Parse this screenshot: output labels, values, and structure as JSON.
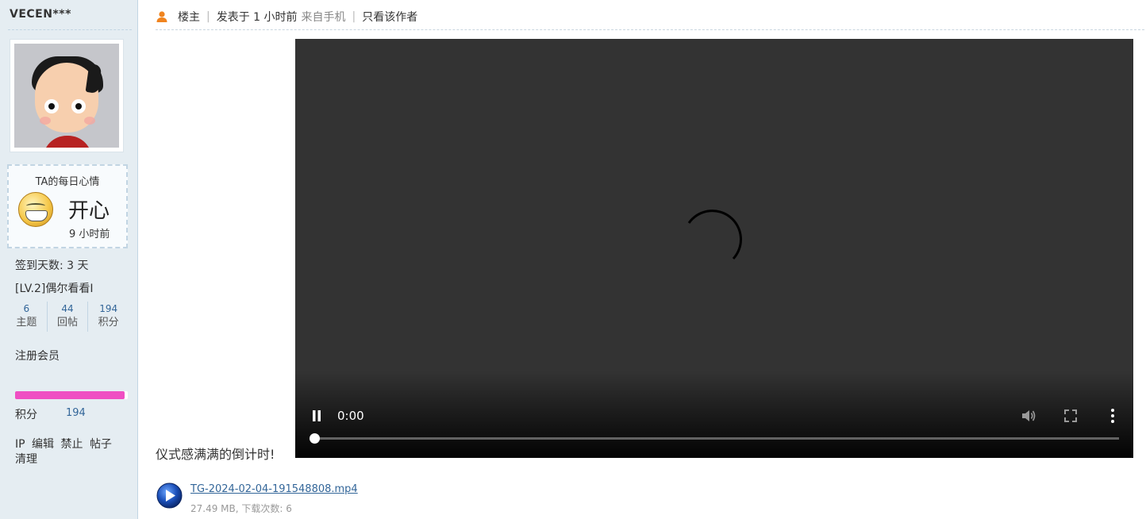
{
  "sidebar": {
    "username": "VECEN***",
    "mood": {
      "title": "TA的每日心情",
      "value": "开心",
      "time": "9 小时前"
    },
    "checkin": "签到天数: 3 天",
    "level": "[LV.2]偶尔看看I",
    "stats": [
      {
        "value": "6",
        "label": "主题"
      },
      {
        "value": "44",
        "label": "回帖"
      },
      {
        "value": "194",
        "label": "积分"
      }
    ],
    "member_group": "注册会员",
    "points_progress": 0.97,
    "points_label": "积分",
    "points_value": "194",
    "admin_links": [
      "IP",
      "编辑",
      "禁止",
      "帖子",
      "清理"
    ]
  },
  "post": {
    "role": "楼主",
    "posted": "发表于 1 小时前",
    "device": "来自手机",
    "only_author": "只看该作者",
    "separator": "|",
    "text": "仪式感满满的倒计时!"
  },
  "video": {
    "time": "0:00",
    "progress": 0
  },
  "attachment": {
    "filename": "TG-2024-02-04-191548808.mp4",
    "meta": "27.49 MB, 下载次数: 6"
  },
  "colors": {
    "sidebar_bg": "#e5edf2",
    "link": "#336699",
    "progress_fill": "#ef4fc3",
    "user_icon": "#f0841f",
    "video_bg": "#333333"
  }
}
